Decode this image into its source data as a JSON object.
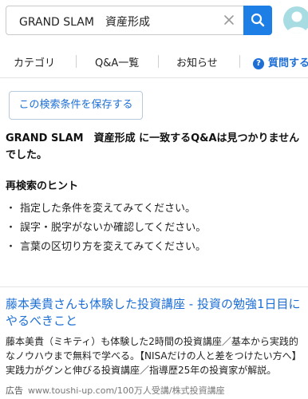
{
  "search": {
    "query": "GRAND SLAM　資産形成",
    "clear_icon": "close-icon",
    "search_icon": "search-icon",
    "button_color": "#1d7ee6"
  },
  "avatar": {
    "icon": "user-avatar",
    "color": "#a8dce3"
  },
  "nav": {
    "items": [
      "カテゴリ",
      "Q&A一覧",
      "お知らせ"
    ],
    "question": "質問する"
  },
  "save_condition_label": "この検索条件を保存する",
  "no_result": "GRAND SLAM　資産形成 に一致するQ&Aは見つかりませんでした。",
  "hints": {
    "title": "再検索のヒント",
    "items": [
      "指定した条件を変えてみてください。",
      "誤字・脱字がないか確認してください。",
      "言葉の区切り方を変えてみてください。"
    ]
  },
  "ad": {
    "title": "藤本美貴さんも体験した投資講座 - 投資の勉強1日目にやるべきこと",
    "description": "藤本美貴（ミキティ）も体験した2時間の投資講座／基本から実践的なノウハウまで無料で学べる。【NISAだけの人と差をつけたい方へ】実践力がグンと伸びる投資講座／指導歴25年の投資家が解説。",
    "label": "広告",
    "url": "www.toushi-up.com/100万人受講/株式投資講座",
    "title_color": "#1d6fd6"
  }
}
